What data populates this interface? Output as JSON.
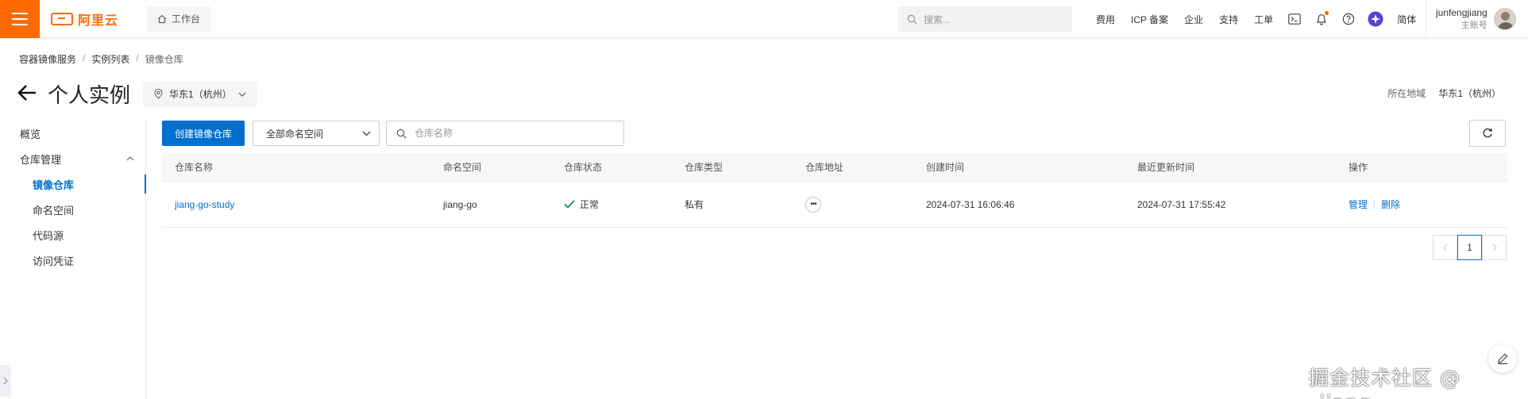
{
  "topbar": {
    "logo_text": "阿里云",
    "workbench_label": "工作台",
    "search_placeholder": "搜索...",
    "nav": [
      "费用",
      "ICP 备案",
      "企业",
      "支持",
      "工单"
    ],
    "lang_label": "简体",
    "user_name": "junfengjiang",
    "user_role": "主账号",
    "accent_color": "#ff6a00"
  },
  "breadcrumb": [
    "容器镜像服务",
    "实例列表",
    "镜像仓库"
  ],
  "page": {
    "title": "个人实例",
    "region_select": "华东1（杭州）",
    "region_info_label": "所在地域",
    "region_info_value": "华东1（杭州）"
  },
  "sidebar": {
    "overview": "概览",
    "group": "仓库管理",
    "items": [
      "镜像仓库",
      "命名空间",
      "代码源",
      "访问凭证"
    ]
  },
  "toolbar": {
    "create_button": "创建镜像仓库",
    "namespace_select": "全部命名空间",
    "search_placeholder": "仓库名称"
  },
  "table": {
    "columns": [
      "仓库名称",
      "命名空间",
      "仓库状态",
      "仓库类型",
      "仓库地址",
      "创建时间",
      "最近更新时间",
      "操作"
    ],
    "rows": [
      {
        "name": "jiang-go-study",
        "namespace": "jiang-go",
        "status": "正常",
        "type": "私有",
        "created": "2024-07-31 16:06:46",
        "updated": "2024-07-31 17:55:42",
        "action_manage": "管理",
        "action_delete": "删除"
      }
    ]
  },
  "pagination": {
    "current": "1"
  },
  "watermark": "掘金技术社区 @ _jiang",
  "colors": {
    "primary": "#0070cc",
    "success": "#1e8e3e"
  }
}
